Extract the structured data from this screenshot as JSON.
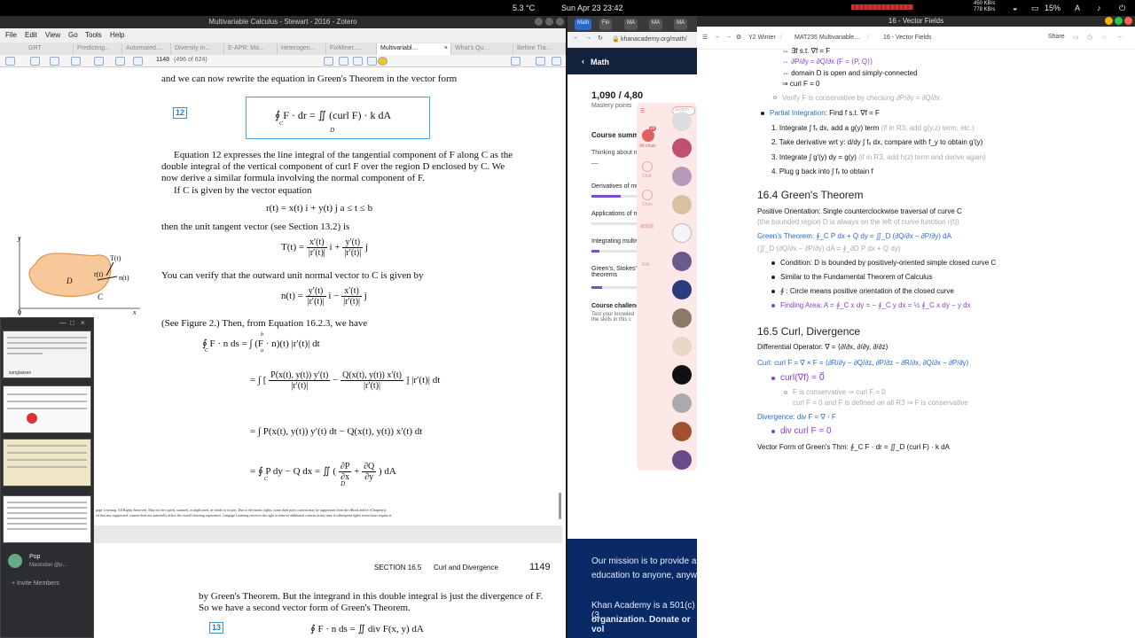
{
  "system": {
    "datetime": "Sun Apr 23  23:42",
    "temperature": "5.3 °C",
    "battery": "15%",
    "net_up": "450 KB/s",
    "net_down": "778 KB/s",
    "input_lang": "A"
  },
  "zotero": {
    "title": "Multivariable Calculus - Stewart - 2016 - Zotero",
    "menu": [
      "File",
      "Edit",
      "View",
      "Go",
      "Tools",
      "Help"
    ],
    "tabs": [
      "GRT",
      "Predicting…",
      "Automated…",
      "Diversity in…",
      "E-APR: Ma…",
      "Heterogen…",
      "FixMiner:…",
      "Multivariabl…",
      "What's Qu…",
      "Before Tra…"
    ],
    "page_indicator": "1148",
    "page_of": "(496 of 624)",
    "pdf": {
      "intro_line": "and we can now rewrite the equation in Green's Theorem in the vector form",
      "eq12_label": "12",
      "eq12": "∮ F · dr = ∬ (curl F) · k dA",
      "eq12_c": "C",
      "eq12_d": "D",
      "para1": "Equation 12 expresses the line integral of the tangential component of F along C as the double integral of the vertical component of curl F over the region D enclosed by C. We now derive a similar formula involving the normal component of F.",
      "para2": "If C is given by the vector equation",
      "eq_r": "r(t) = x(t) i + y(t) j        a ≤ t ≤ b",
      "para3": "then the unit tangent vector (see Section 13.2) is",
      "eq_T_lhs": "T(t) =",
      "eq_T_n1": "x′(t)",
      "eq_T_d1": "|r′(t)|",
      "eq_T_m1": "i +",
      "eq_T_n2": "y′(t)",
      "eq_T_d2": "|r′(t)|",
      "eq_T_m2": "j",
      "para4": "You can verify that the outward unit normal vector to C is given by",
      "eq_n_lhs": "n(t) =",
      "eq_n_n1": "y′(t)",
      "eq_n_d1": "|r′(t)|",
      "eq_n_m1": "i −",
      "eq_n_n2": "x′(t)",
      "eq_n_d2": "|r′(t)|",
      "eq_n_m2": "j",
      "para5": "(See Figure 2.) Then, from Equation 16.2.3, we have",
      "der1": "∮ F · n ds = ∫ (F · n)(t) |r′(t)| dt",
      "der1_c": "C",
      "der1_a": "a",
      "der1_b": "b",
      "der2_lhs": "= ∫ [",
      "der2_n1": "P(x(t), y(t)) y′(t)",
      "der2_d1": "|r′(t)|",
      "der2_mid": "−",
      "der2_n2": "Q(x(t), y(t)) x′(t)",
      "der2_d2": "|r′(t)|",
      "der2_rhs": "] |r′(t)| dt",
      "der3": "= ∫ P(x(t), y(t)) y′(t) dt − Q(x(t), y(t)) x′(t) dt",
      "der4_lhs": "= ∮ P dy − Q dx = ∬ (",
      "der4_n1": "∂P",
      "der4_d1": "∂x",
      "der4_mid": "+",
      "der4_n2": "∂Q",
      "der4_d2": "∂y",
      "der4_rhs": ") dA",
      "der4_c": "C",
      "der4_d": "D",
      "copyright1": "gage Learning. All Rights Reserved. May not be copied, scanned, or duplicated, in whole or in part. Due to electronic rights, some third party content may be suppressed from the eBook and/or eChapter(s).",
      "copyright2": "ed that any suppressed content does not materially affect the overall learning experience. Cengage Learning reserves the right to remove additional content at any time if subsequent rights restrictions require it.",
      "section_label": "SECTION 16.5",
      "section_title": "Curl and Divergence",
      "page_number": "1149",
      "para6": "by Green's Theorem. But the integrand in this double integral is just the divergence of F. So we have a second vector form of Green's Theorem.",
      "eq13_label": "13",
      "eq13": "∮ F · n ds = ∬ div F(x, y) dA",
      "figure": {
        "y": "y",
        "x": "x",
        "origin": "0",
        "D": "D",
        "C": "C",
        "T": "T(t)",
        "r": "r(t)",
        "n": "n(t)"
      }
    }
  },
  "overlay": {
    "user_name": "Pop",
    "user_status": "Mastodon @p…",
    "invite": "Invite Members",
    "thumb_caption": "sunglasses"
  },
  "khan": {
    "tabs": [
      "Math",
      "Fin",
      "MA",
      "MA",
      "MA"
    ],
    "url": "khanacademy.org/math/",
    "breadcrumb": "Math",
    "mastery_value": "1,090 / 4,80",
    "mastery_label": "Mastery points",
    "course_summary": "Course summar",
    "thinking": "Thinking about m",
    "thinking_dash": "––",
    "units": [
      {
        "label": "Derivatives of mu",
        "progress": 0.55
      },
      {
        "label": "Applications of m",
        "progress": 0
      },
      {
        "label": "Integrating multiv",
        "progress": 0.15
      },
      {
        "label": "Green's, Stokes', a theorems",
        "progress": 0.2
      }
    ],
    "challenge_title": "Course challenge",
    "challenge_text": "Test your knowled the skills in this c",
    "side_labels": [
      "Search",
      "All chats",
      "Chat",
      "Chan",
      "编辑器",
      "Edit"
    ],
    "side_badge": "29",
    "footer_line1": "Our mission is to provide a",
    "footer_line2": "education to anyone, anyw",
    "footer_line3": "Khan Academy is a 501(c)(3",
    "footer_line4": "organization. Donate or vol",
    "footer_donate": "Donate"
  },
  "notes": {
    "window_title": "16 - Vector Fields",
    "breadcrumb": [
      "Y2 Winter",
      "MAT235 Multivariable…",
      "16 - Vector Fields"
    ],
    "share": "Share",
    "top_lines": [
      "⇔ ∃f s.t. ∇f = F",
      "⇔ ∂P/∂y = ∂Q/∂x  (F = ⟨P, Q⟩)",
      "⇔ domain D is open and simply-connected",
      "⇒ curl F = 0"
    ],
    "verify_line": "Verify F is conservative by checking ∂P/∂y = ∂Q/∂x",
    "partial_label": "Partial Integration",
    "partial_text": ": Find f s.t. ∇f = F",
    "steps": [
      {
        "num": "1.",
        "text": "Integrate ∫ fₓ dx, add a g(y) term",
        "hint": "(if in R3, add g(y,z) term, etc.)"
      },
      {
        "num": "2.",
        "text": "Take derivative wrt y: d/dy ∫ fₓ dx, compare with f_y to obtain g′(y)",
        "hint": ""
      },
      {
        "num": "3.",
        "text": "Integrate ∫ g′(y) dy = g(y)",
        "hint": "(if in R3, add h(z) term and derive again)"
      },
      {
        "num": "4.",
        "text": "Plug g back into ∫ fₓ to obtain f",
        "hint": ""
      }
    ],
    "h_green": "16.4 Green's Theorem",
    "pos_orient_label": "Positive Orientation",
    "pos_orient_text": ": Single counterclockwise traversal of curve C",
    "pos_orient_hint": "(the bounded region D is always on the left of curve function r(t))",
    "green_label": "Green's Theorem",
    "green_formula": ": ∮_C P dx + Q dy = ∬_D (∂Q/∂x − ∂P/∂y) dA",
    "green_alt": "(∬_D (∂Q/∂x − ∂P/∂y) dA = ∮_∂D P dx + Q dy)",
    "green_bullets": [
      "Condition: D is bounded by positively-oriented simple closed curve C",
      "Similar to the Fundamental Theorem of Calculus",
      "∮ : Circle means positive orientation of the closed curve"
    ],
    "finding_area_label": "Finding Area",
    "finding_area_formula": ": A = ∮_C x dy = − ∮_C y dx = ½ ∮_C x dy − y dx",
    "h_curl": "16.5 Curl, Divergence",
    "diffop_label": "Differential Operator",
    "diffop_text": ": ∇ = ⟨∂/∂x, ∂/∂y, ∂/∂z⟩",
    "curl_label": "Curl",
    "curl_text": ": curl F = ∇ × F = ⟨∂R/∂y − ∂Q/∂z, ∂P/∂z − ∂R/∂x, ∂Q/∂x − ∂P/∂y⟩",
    "curl_grad": "curl(∇f) = 0⃗",
    "curl_sub1": "F is conservative ⇒ curl F = 0",
    "curl_sub2": "curl F = 0 and F is defined on all R3 ⇒ F is conservative",
    "div_label": "Divergence",
    "div_text": ": div F = ∇ · F",
    "div_curl": "div curl F = 0",
    "vector_form": "Vector Form of Green's Thm: ∮_C F · dr = ∬_D (curl F) · k dA"
  },
  "colors": {
    "blue_label": "#2a6ad0",
    "purple_label": "#8a3fd0",
    "khan_footer": "#0a2a66",
    "pdf_eq_border": "#4aa3df",
    "region_fill": "#f6c89a"
  }
}
